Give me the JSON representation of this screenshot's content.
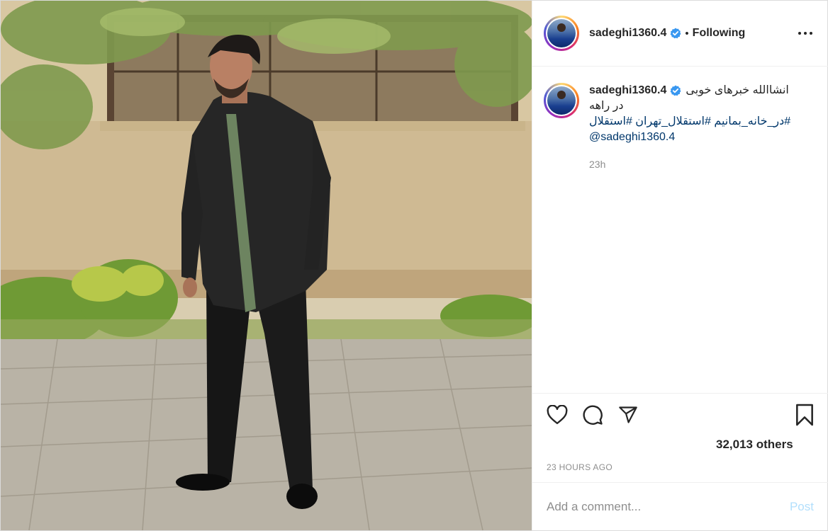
{
  "post": {
    "username": "sadeghi1360.4",
    "verified": true,
    "separator": "•",
    "follow_state": "Following",
    "more_icon": "more-horizontal-icon",
    "caption": {
      "username": "sadeghi1360.4",
      "text_line1": "انشاالله خبرهای خوبی",
      "text_line2": "در راهه",
      "hashtags": "#در_خانه_بمانیم #استقلال_تهران #استقلال",
      "mention": "@sadeghi1360.4",
      "time": "23h"
    },
    "actions": {
      "like_icon": "heart-icon",
      "comment_icon": "comment-icon",
      "share_icon": "send-icon",
      "save_icon": "bookmark-icon"
    },
    "likes_text": "32,013 others",
    "timestamp": "23 HOURS AGO",
    "comment": {
      "placeholder": "Add a comment...",
      "post_label": "Post"
    },
    "colors": {
      "verified": "#3897f0",
      "link": "#00376b",
      "post_button_disabled": "#b2dffc",
      "muted": "#8e8e8e"
    }
  }
}
